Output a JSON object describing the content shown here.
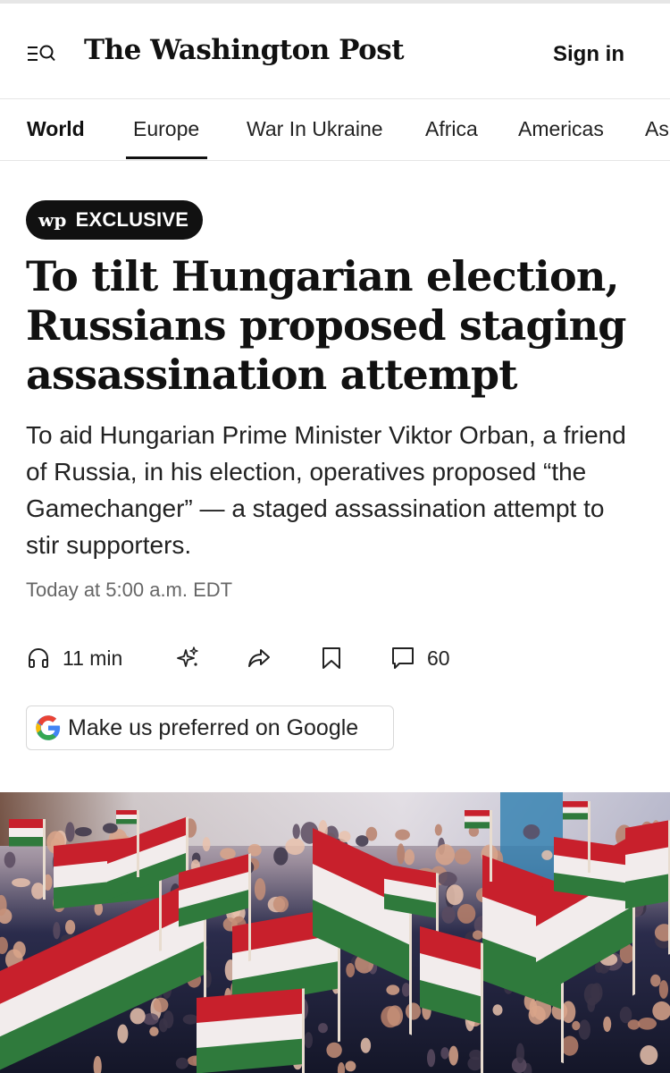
{
  "header": {
    "logo_text": "The Washington Post",
    "sign_in_label": "Sign in",
    "menu_icon": "menu-search-icon"
  },
  "nav": {
    "items": [
      {
        "label": "World",
        "bold": true
      },
      {
        "label": "Europe",
        "active": true
      },
      {
        "label": "War In Ukraine"
      },
      {
        "label": "Africa"
      },
      {
        "label": "Americas"
      },
      {
        "label": "As"
      }
    ]
  },
  "article": {
    "badge_mark": "wp",
    "badge_label": "EXCLUSIVE",
    "headline": "To tilt Hungarian election, Russians proposed staging assassination attempt",
    "dek": "To aid Hungarian Prime Minister Viktor Orban, a friend of Russia, in his election, operatives proposed “the Gamechanger” — a staged assassination attempt to stir supporters.",
    "timestamp": "Today at 5:00 a.m. EDT"
  },
  "actions": {
    "listen_label": "11 min",
    "listen_icon": "headphones-icon",
    "ai_icon": "sparkle-icon",
    "share_icon": "share-icon",
    "save_icon": "bookmark-icon",
    "comment_icon": "comment-icon",
    "comments_count": "60"
  },
  "google_pref": {
    "label": "Make us preferred on Google",
    "icon": "google-g-icon"
  },
  "hero": {
    "description_icon": "hero-photo",
    "colors": {
      "red": "#c8202c",
      "white": "#f2ecec",
      "green": "#2f7a3c"
    }
  }
}
